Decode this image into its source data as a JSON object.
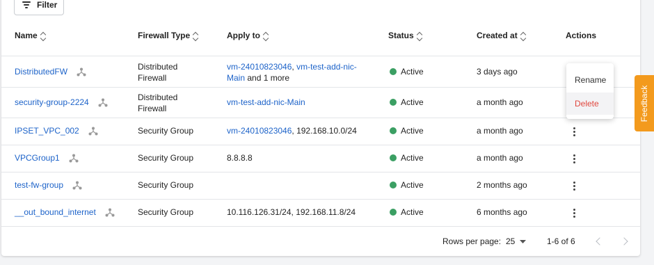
{
  "toolbar": {
    "filter_label": "Filter"
  },
  "table": {
    "headers": {
      "name": "Name",
      "firewall_type": "Firewall Type",
      "apply_to": "Apply to",
      "status": "Status",
      "created_at": "Created at",
      "actions": "Actions"
    },
    "rows": [
      {
        "name": "DistributedFW",
        "type_line1": "Distributed",
        "type_line2": "Firewall",
        "apply_link1": "vm-24010823046",
        "apply_sep": ", ",
        "apply_link2": "vm-test-add-nic-",
        "apply_link3": "Main",
        "apply_more": " and 1 more",
        "status": "Active",
        "created": "3 days ago"
      },
      {
        "name": "security-group-2224",
        "type_line1": "Distributed",
        "type_line2": "Firewall",
        "apply_link1": "vm-test-add-nic-Main",
        "status": "Active",
        "created": "a month ago"
      },
      {
        "name": "IPSET_VPC_002",
        "type": "Security Group",
        "apply_link1": "vm-24010823046",
        "apply_rest": ", 192.168.10.0/24",
        "status": "Active",
        "created": "a month ago"
      },
      {
        "name": "VPCGroup1",
        "type": "Security Group",
        "apply_text": "8.8.8.8",
        "status": "Active",
        "created": "a month ago"
      },
      {
        "name": "test-fw-group",
        "type": "Security Group",
        "apply_text": "",
        "status": "Active",
        "created": "2 months ago"
      },
      {
        "name": "__out_bound_internet",
        "type": "Security Group",
        "apply_text": "10.116.126.31/24, 192.168.11.8/24",
        "status": "Active",
        "created": "6 months ago"
      }
    ]
  },
  "actions_menu": {
    "rename": "Rename",
    "delete": "Delete"
  },
  "pagination": {
    "rows_per_page_label": "Rows per page:",
    "rows_per_page_value": "25",
    "range": "1-6 of 6"
  },
  "feedback_label": "Feedback",
  "colors": {
    "link": "#1d63c9",
    "status_active": "#3b9f63",
    "delete": "#e0473e",
    "feedback": "#f39a1d"
  },
  "icons": {
    "filter": "filter-lines-icon",
    "sort": "sort-updown-icon",
    "group": "share-nodes-icon",
    "kebab": "more-vert-icon",
    "dropdown": "caret-down-icon",
    "prev": "chevron-left-icon",
    "next": "chevron-right-icon"
  }
}
